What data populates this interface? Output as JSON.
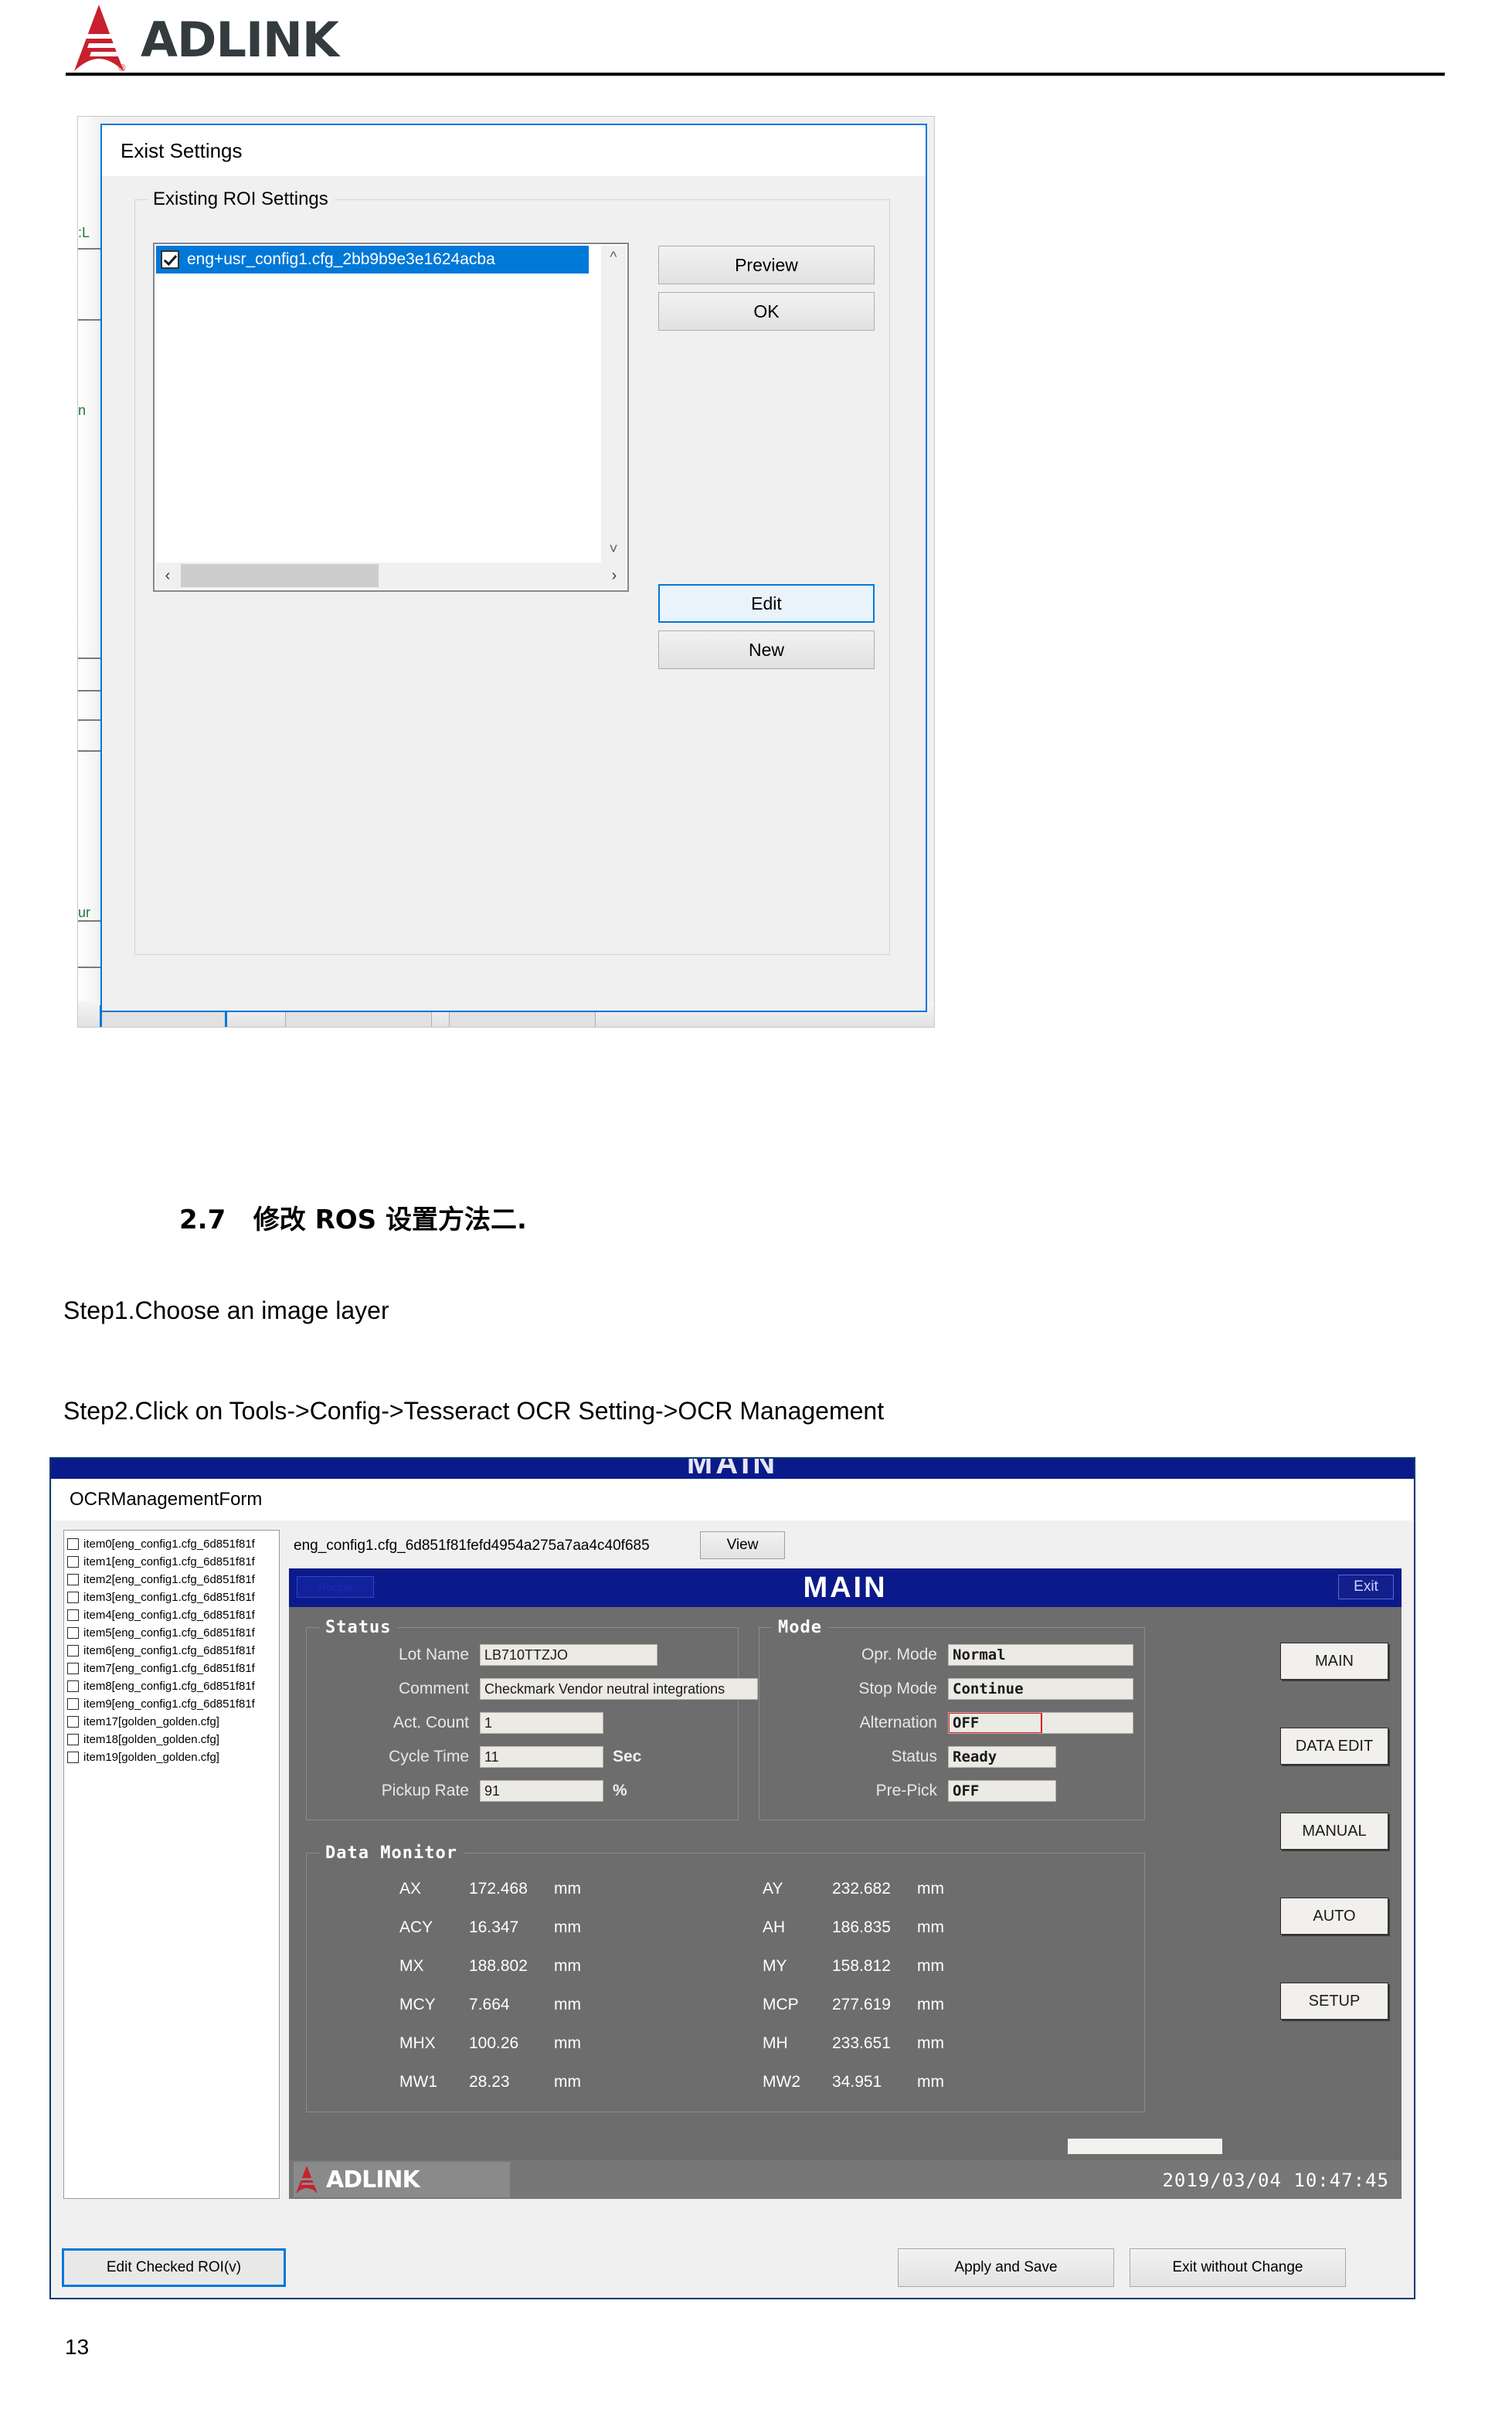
{
  "header": {
    "brand": "ADLINK"
  },
  "background_window": {
    "green_fragments": [
      ":L",
      "n",
      "ur"
    ]
  },
  "exist_settings_dialog": {
    "title": "Exist Settings",
    "group_label": "Existing ROI Settings",
    "list_items": [
      {
        "label": "eng+usr_config1.cfg_2bb9b9e3e1624acba",
        "checked": true,
        "selected": true
      }
    ],
    "buttons": {
      "preview": "Preview",
      "ok": "OK",
      "edit": "Edit",
      "new": "New"
    }
  },
  "document": {
    "heading": "2.7   修改 ROS 设置方法二.",
    "step1": "Step1.Choose an image layer",
    "step2": "Step2.Click on Tools->Config->Tesseract OCR Setting->OCR Management",
    "page_number": "13"
  },
  "ocr_form": {
    "title": "OCRManagementForm",
    "ghost_title": "MAIN",
    "config_name": "eng_config1.cfg_6d851f81fefd4954a275a7aa4c40f685",
    "view_button": "View",
    "roi_items": [
      "item0[eng_config1.cfg_6d851f81f",
      "item1[eng_config1.cfg_6d851f81f",
      "item2[eng_config1.cfg_6d851f81f",
      "item3[eng_config1.cfg_6d851f81f",
      "item4[eng_config1.cfg_6d851f81f",
      "item5[eng_config1.cfg_6d851f81f",
      "item6[eng_config1.cfg_6d851f81f",
      "item7[eng_config1.cfg_6d851f81f",
      "item8[eng_config1.cfg_6d851f81f",
      "item9[eng_config1.cfg_6d851f81f",
      "item17[golden_golden.cfg]",
      "item18[golden_golden.cfg]",
      "item19[golden_golden.cfg]"
    ],
    "bottom_buttons": {
      "edit_checked": "Edit Checked ROI(v)",
      "apply_and_save": "Apply and Save",
      "exit_without_change": "Exit without Change"
    }
  },
  "hmi": {
    "header_title": "MAIN",
    "header_left_button": "Recipe",
    "header_exit_button": "Exit",
    "status": {
      "panel_title": "Status",
      "rows": [
        {
          "label": "Lot Name",
          "value": "LB710TTZJO",
          "unit": ""
        },
        {
          "label": "Comment",
          "value": "Checkmark Vendor neutral integrations",
          "unit": ""
        },
        {
          "label": "Act. Count",
          "value": "1",
          "unit": ""
        },
        {
          "label": "Cycle Time",
          "value": "11",
          "unit": "Sec"
        },
        {
          "label": "Pickup Rate",
          "value": "91",
          "unit": "%"
        }
      ]
    },
    "mode": {
      "panel_title": "Mode",
      "rows": [
        {
          "label": "Opr. Mode",
          "value": "Normal",
          "highlight": false
        },
        {
          "label": "Stop Mode",
          "value": "Continue",
          "highlight": false
        },
        {
          "label": "Alternation",
          "value": "OFF",
          "highlight": true
        },
        {
          "label": "Status",
          "value": "Ready",
          "highlight": false
        },
        {
          "label": "Pre-Pick",
          "value": "OFF",
          "highlight": false
        }
      ]
    },
    "data_monitor": {
      "panel_title": "Data Monitor",
      "left": [
        {
          "key": "AX",
          "value": "172.468",
          "unit": "mm"
        },
        {
          "key": "ACY",
          "value": "16.347",
          "unit": "mm"
        },
        {
          "key": "MX",
          "value": "188.802",
          "unit": "mm"
        },
        {
          "key": "MCY",
          "value": "7.664",
          "unit": "mm"
        },
        {
          "key": "MHX",
          "value": "100.26",
          "unit": "mm"
        },
        {
          "key": "MW1",
          "value": "28.23",
          "unit": "mm"
        }
      ],
      "right": [
        {
          "key": "AY",
          "value": "232.682",
          "unit": "mm"
        },
        {
          "key": "AH",
          "value": "186.835",
          "unit": "mm"
        },
        {
          "key": "MY",
          "value": "158.812",
          "unit": "mm"
        },
        {
          "key": "MCP",
          "value": "277.619",
          "unit": "mm"
        },
        {
          "key": "MH",
          "value": "233.651",
          "unit": "mm"
        },
        {
          "key": "MW2",
          "value": "34.951",
          "unit": "mm"
        }
      ]
    },
    "side_buttons": [
      "MAIN",
      "DATA EDIT",
      "MANUAL",
      "AUTO",
      "SETUP"
    ],
    "footer": {
      "brand": "ADLINK",
      "timestamp": "2019/03/04 10:47:45"
    }
  },
  "colors": {
    "accent_blue": "#0078d7",
    "hmi_navy": "#0b1a8a",
    "hmi_gray": "#6d6d6d",
    "brand_red": "#c8202e",
    "alert_red": "#e01b1b"
  }
}
